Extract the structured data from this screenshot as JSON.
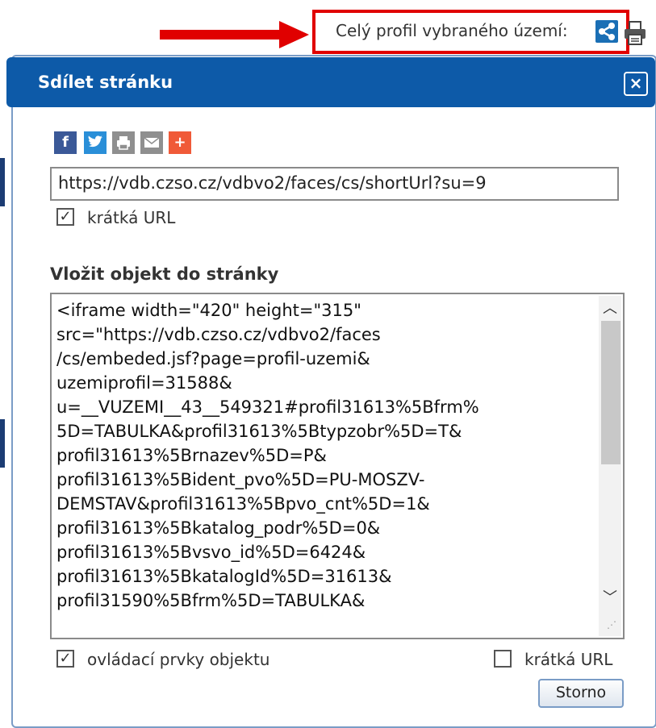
{
  "header": {
    "profile_label": "Celý profil vybraného území:",
    "share_icon": "share-icon",
    "print_icon": "print-icon",
    "highlight_color": "#e00000"
  },
  "dialog": {
    "title": "Sdílet stránku",
    "close_label": "×",
    "title_color": "#0d5aa8",
    "social_buttons": [
      {
        "name": "facebook",
        "glyph": "f",
        "color": "#3b5998"
      },
      {
        "name": "twitter",
        "glyph": "t",
        "color": "#2a8fd8"
      },
      {
        "name": "print",
        "glyph": "⎙",
        "color": "#8f8f8f"
      },
      {
        "name": "email",
        "glyph": "✉",
        "color": "#8f8f8f"
      },
      {
        "name": "more",
        "glyph": "+",
        "color": "#f05a38"
      }
    ],
    "url_value": "https://vdb.czso.cz/vdbvo2/faces/cs/shortUrl?su=9",
    "short_url_checked": true,
    "short_url_label": "krátká URL",
    "embed_heading": "Vložit objekt do stránky",
    "embed_code": "<iframe width=\"420\" height=\"315\"\nsrc=\"https://vdb.czso.cz/vdbvo2/faces\n/cs/embeded.jsf?page=profil-uzemi&\nuzemiprofil=31588&\nu=__VUZEMI__43__549321#profil31613%5Bfrm%\n5D=TABULKA&profil31613%5Btypzobr%5D=T&\nprofil31613%5Brnazev%5D=P&\nprofil31613%5Bident_pvo%5D=PU-MOSZV-\nDEMSTAV&profil31613%5Bpvo_cnt%5D=1&\nprofil31613%5Bkatalog_podr%5D=0&\nprofil31613%5Bvsvo_id%5D=6424&\nprofil31613%5BkatalogId%5D=31613&\nprofil31590%5Bfrm%5D=TABULKA&",
    "controls_checked": true,
    "controls_label": "ovládací prvky objektu",
    "embed_short_url_checked": false,
    "embed_short_url_label": "krátká URL",
    "cancel_label": "Storno"
  }
}
